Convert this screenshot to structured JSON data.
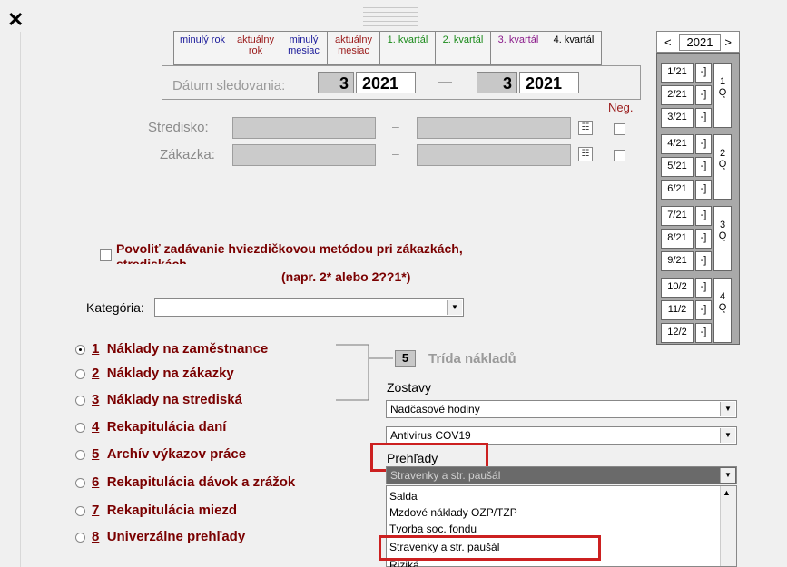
{
  "close_label": "✕",
  "tabs": [
    {
      "label": "minulý rok",
      "color": "#1a1a9a"
    },
    {
      "label": "aktuálny rok",
      "color": "#9a1a1a"
    },
    {
      "label": "minulý mesiac",
      "color": "#1a1a9a"
    },
    {
      "label": "aktuálny mesiac",
      "color": "#9a1a1a"
    },
    {
      "label": "1. kvartál",
      "color": "#1a8a1a"
    },
    {
      "label": "2. kvartál",
      "color": "#1a8a1a"
    },
    {
      "label": "3. kvartál",
      "color": "#8a1a8a"
    },
    {
      "label": "4. kvartál",
      "color": "#000000"
    }
  ],
  "date": {
    "label": "Dátum sledovania:",
    "from_month": "3",
    "from_year": "2021",
    "separator": "—",
    "to_month": "3",
    "to_year": "2021"
  },
  "neg_label": "Neg.",
  "stredisko": {
    "label": "Stredisko:",
    "dash": "–"
  },
  "zakazka": {
    "label": "Zákazka:",
    "dash": "–"
  },
  "star_method": {
    "line1": "Povoliť zadávanie hviezdičkovou metódou pri zákazkách,",
    "line2": "strediskách",
    "hint": "(napr. 2* alebo 2??1*)"
  },
  "kategoria": {
    "label": "Kategória:",
    "value": ""
  },
  "radios": [
    {
      "num": "1",
      "label": "Náklady na zaměstnance",
      "selected": true
    },
    {
      "num": "2",
      "label": "Náklady na zákazky",
      "selected": false
    },
    {
      "num": "3",
      "label": "Náklady na strediská",
      "selected": false
    },
    {
      "num": "4",
      "label": "Rekapitulácia daní",
      "selected": false
    },
    {
      "num": "5",
      "label": "Archív výkazov práce",
      "selected": false
    },
    {
      "num": "6",
      "label": "Rekapitulácia dávok a zrážok",
      "selected": false
    },
    {
      "num": "7",
      "label": "Rekapitulácia miezd",
      "selected": false
    },
    {
      "num": "8",
      "label": "Univerzálne prehľady",
      "selected": false
    }
  ],
  "trida": {
    "num": "5",
    "label": "Trída nákladů"
  },
  "zostavy": {
    "label": "Zostavy",
    "combo1": "Nadčasové hodiny",
    "combo2": "Antivirus COV19"
  },
  "prehlady": {
    "label": "Prehľady",
    "selected": "Stravenky a str. paušál",
    "options": [
      "Salda",
      "Mzdové náklady OZP/TZP",
      "Tvorba soc. fondu",
      "Stravenky a str. paušál",
      "Riziká"
    ]
  },
  "year_nav": {
    "prev": "<",
    "year": "2021",
    "next": ">"
  },
  "months": [
    {
      "label": "1/21",
      "btn": "-]"
    },
    {
      "label": "2/21",
      "btn": "-]"
    },
    {
      "label": "3/21",
      "btn": "-]"
    },
    {
      "label": "4/21",
      "btn": "-]"
    },
    {
      "label": "5/21",
      "btn": "-]"
    },
    {
      "label": "6/21",
      "btn": "-]"
    },
    {
      "label": "7/21",
      "btn": "-]"
    },
    {
      "label": "8/21",
      "btn": "-]"
    },
    {
      "label": "9/21",
      "btn": "-]"
    },
    {
      "label": "10/2",
      "btn": "-]"
    },
    {
      "label": "11/2",
      "btn": "-]"
    },
    {
      "label": "12/2",
      "btn": "-]"
    }
  ],
  "quarters": [
    {
      "num": "1",
      "q": "Q"
    },
    {
      "num": "2",
      "q": "Q"
    },
    {
      "num": "3",
      "q": "Q"
    },
    {
      "num": "4",
      "q": "Q"
    }
  ],
  "colors": {
    "highlight": "#cc2020",
    "dark_red": "#7a0000",
    "selected_item": "#6a6a6a"
  }
}
